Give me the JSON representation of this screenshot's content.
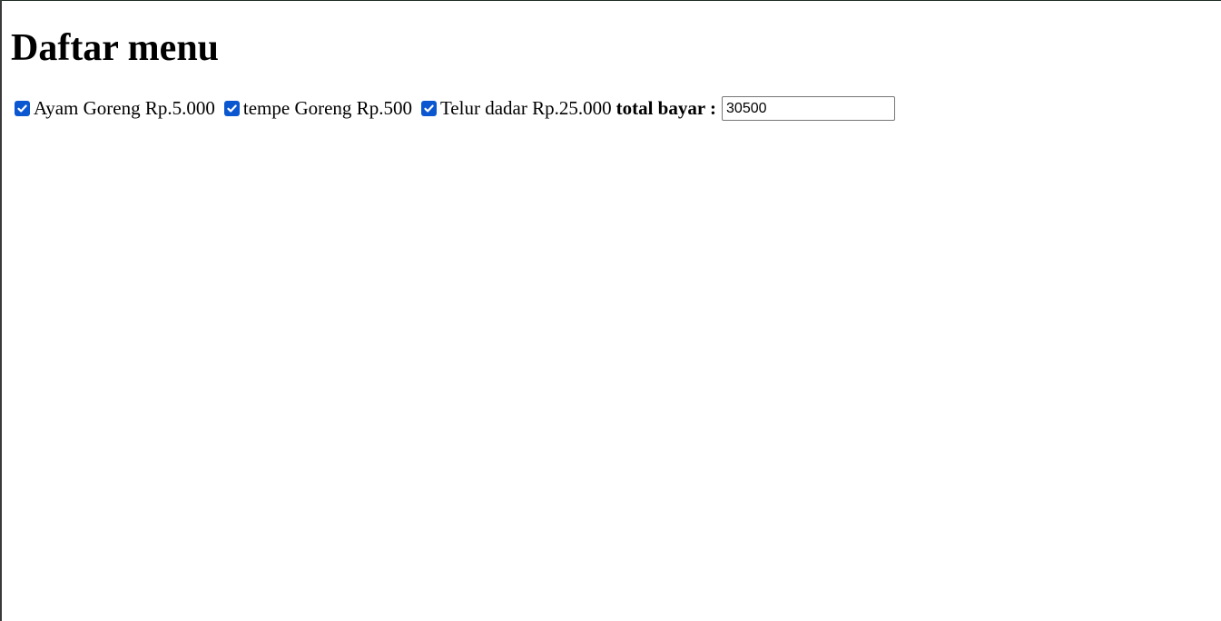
{
  "page": {
    "title": "Daftar menu"
  },
  "menu": {
    "items": [
      {
        "label": "Ayam Goreng Rp.5.000",
        "checked": true
      },
      {
        "label": "tempe Goreng Rp.500",
        "checked": true
      },
      {
        "label": "Telur dadar Rp.25.000",
        "checked": true
      }
    ],
    "total_label": "total bayar :",
    "total_value": "30500"
  },
  "colors": {
    "checkbox_accent": "#0b57d0",
    "input_border": "#767676"
  },
  "icons": {
    "check": "check-icon"
  }
}
